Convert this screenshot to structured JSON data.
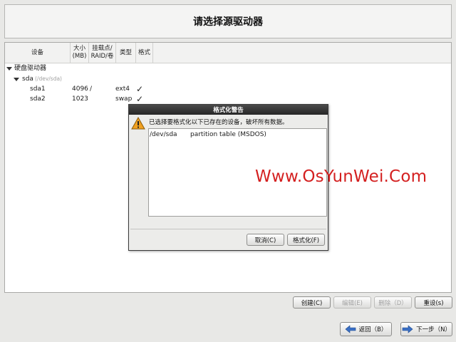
{
  "header": {
    "title": "请选择源驱动器"
  },
  "table": {
    "columns": [
      "设备",
      "大小\n(MB)",
      "挂载点/\nRAID/卷",
      "类型",
      "格式"
    ],
    "tree": {
      "group_label": "硬盘驱动器",
      "disk": {
        "name": "sda",
        "path": "(/dev/sda)"
      },
      "partitions": [
        {
          "name": "sda1",
          "size": "4096",
          "mount": "/",
          "type": "ext4",
          "format": "✓"
        },
        {
          "name": "sda2",
          "size": "1023",
          "mount": "",
          "type": "swap",
          "format": "✓"
        }
      ]
    }
  },
  "dialog": {
    "title": "格式化警告",
    "message": "已选择要格式化以下已存在的设备，破坏所有数据。",
    "rows": [
      {
        "device": "/dev/sda",
        "description": "partition table (MSDOS)"
      }
    ],
    "cancel_label": "取消(C)",
    "format_label": "格式化(F)"
  },
  "actions": {
    "create_label": "创建(C)",
    "edit_label": "编辑(E)",
    "delete_label": "删除（D）",
    "reset_label": "重设(s)"
  },
  "nav": {
    "back_label": "返回（B）",
    "next_label": "下一步（N）"
  },
  "watermark": {
    "text": "Www.OsYunWei.Com"
  },
  "colors": {
    "watermark": "#d42020",
    "warning_icon": "#f0a020",
    "arrow_icon": "#3a6fc4"
  },
  "icons": {
    "warning": "warning-icon",
    "back": "back-arrow-icon",
    "next": "next-arrow-icon"
  }
}
